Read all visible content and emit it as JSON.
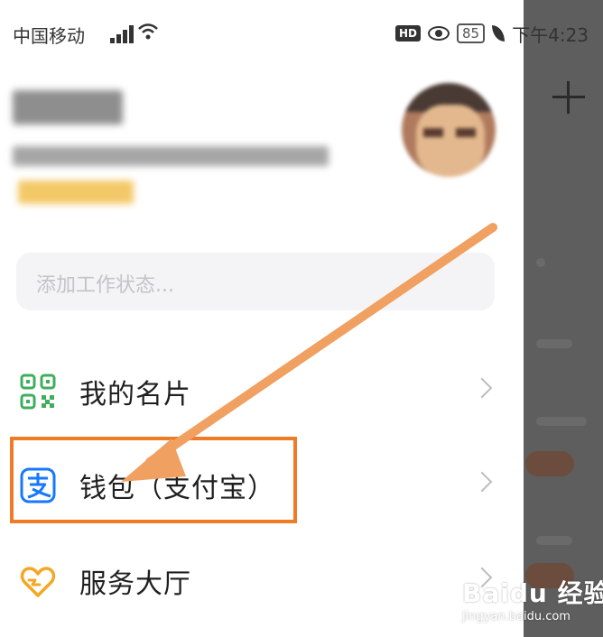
{
  "status_bar": {
    "carrier": "中国移动",
    "hd_badge": "HD",
    "battery_level": "85",
    "time": "下午4:23"
  },
  "work_status": {
    "placeholder": "添加工作状态..."
  },
  "menu": {
    "items": [
      {
        "label": "我的名片",
        "icon": "qr-code-icon"
      },
      {
        "label": "钱包（支付宝）",
        "icon": "alipay-icon"
      },
      {
        "label": "服务大厅",
        "icon": "heart-hands-icon"
      }
    ]
  },
  "watermark": {
    "logo": "Bai",
    "logo_paw": "du",
    "logo_suffix": "经验",
    "url": "jingyan.baidu.com"
  },
  "colors": {
    "highlight": "#f07b27",
    "arrow": "#f0a060",
    "qr_green": "#3fae5c",
    "alipay_blue": "#1677ff",
    "service_orange": "#f5a623"
  }
}
